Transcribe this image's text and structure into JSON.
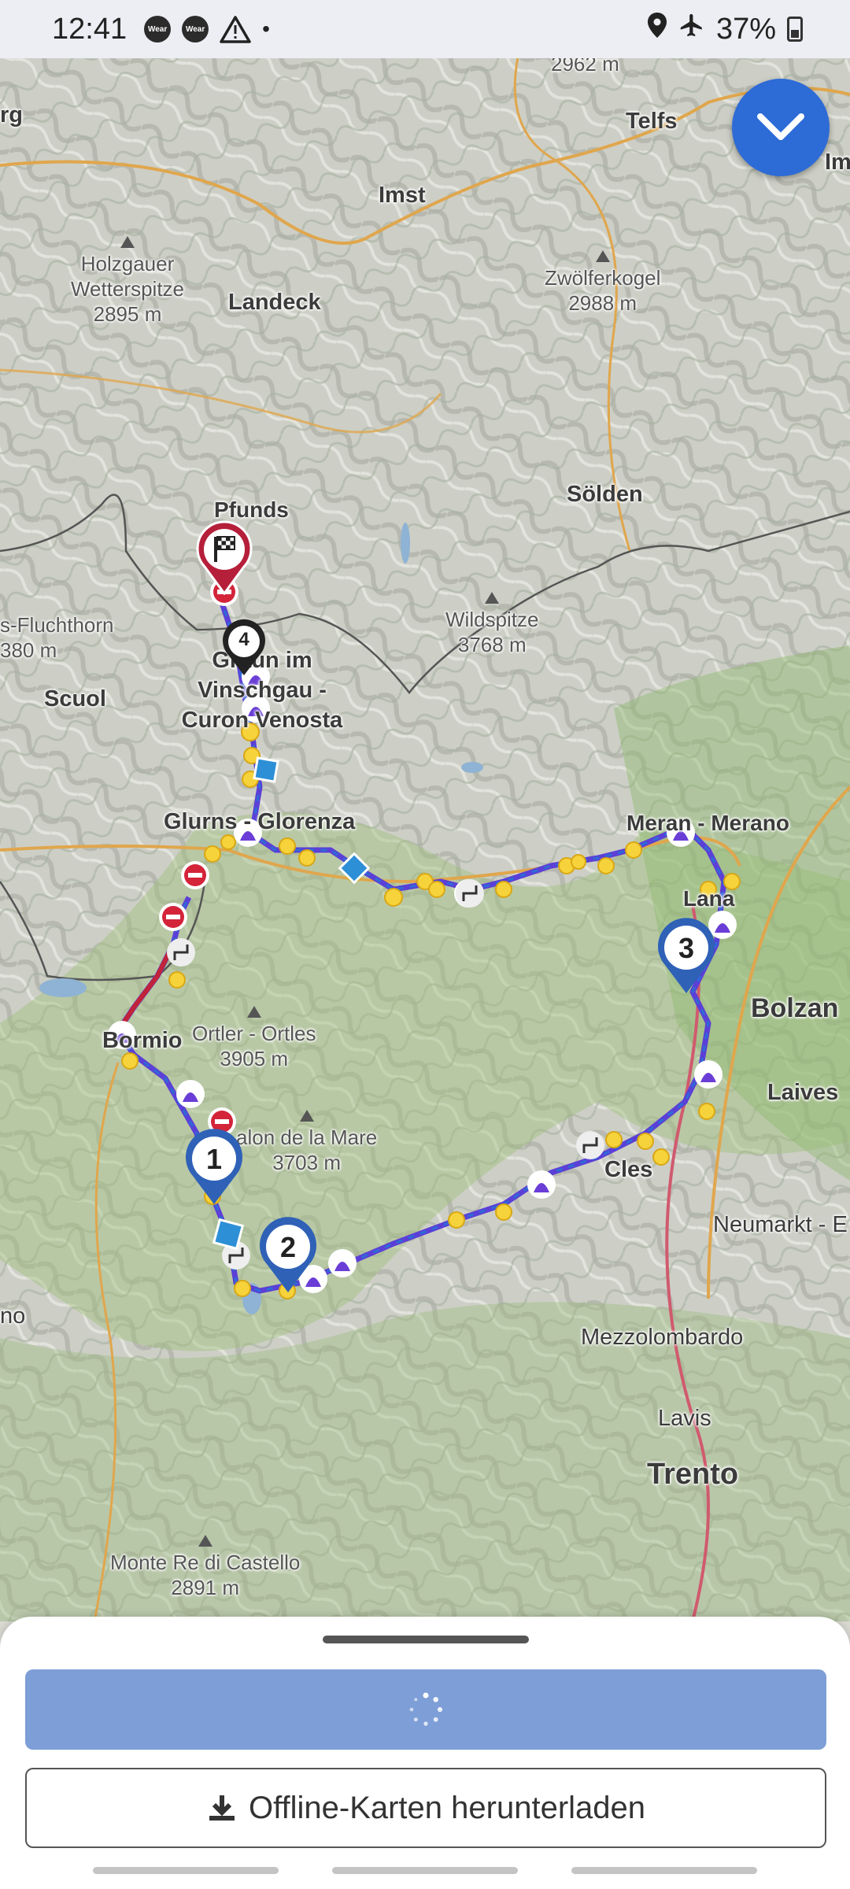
{
  "status_bar": {
    "time": "12:41",
    "wear_label": "Wear",
    "warning_icon": "warning-icon",
    "dot": "•",
    "battery_percent": "37%",
    "icons": [
      "wear-icon",
      "wear-icon",
      "warning-icon",
      "location-icon",
      "airplane-icon",
      "battery-icon"
    ]
  },
  "map": {
    "towns": {
      "top_elev": "2962 m",
      "telfs": "Telfs",
      "imst": "Imst",
      "landeck": "Landeck",
      "pfunds": "Pfunds",
      "solden": "Sölden",
      "scuol": "Scuol",
      "graun": "Graun im Vinschgau - Curon Venosta",
      "glurns": "Glurns - Glorenza",
      "meran": "Meran - Merano",
      "lana": "Lana",
      "bolzano": "Bolzan",
      "bormio": "Bormio",
      "laives": "Laives",
      "cles": "Cles",
      "neumarkt": "Neumarkt - E",
      "mezzolombardo": "Mezzolombardo",
      "lavis": "Lavis",
      "trento": "Trento",
      "edge_org": "rg",
      "edge_im": "Im",
      "edge_no": "no"
    },
    "peaks": {
      "holzgauer": {
        "name": "Holzgauer Wetterspitze",
        "elev": "2895 m"
      },
      "zwolferkogel": {
        "name": "Zwölferkogel",
        "elev": "2988 m"
      },
      "fluchthorn": {
        "name": "s-Fluchthorn",
        "elev": "380 m"
      },
      "wildspitze": {
        "name": "Wildspitze",
        "elev": "3768 m"
      },
      "ortler": {
        "name": "Ortler - Ortles",
        "elev": "3905 m"
      },
      "palon": {
        "name": "alon de la Mare",
        "elev": "3703 m"
      },
      "monte_re": {
        "name": "Monte Re di Castello",
        "elev": "2891 m"
      }
    },
    "waypoints": [
      "1",
      "2",
      "3",
      "4"
    ],
    "route_color": "#5b3fd6",
    "accent_color": "#2d6bd6"
  },
  "sheet": {
    "primary_button_state": "loading",
    "offline_button_label": "Offline-Karten herunterladen",
    "offline_button_icon": "download-icon"
  }
}
